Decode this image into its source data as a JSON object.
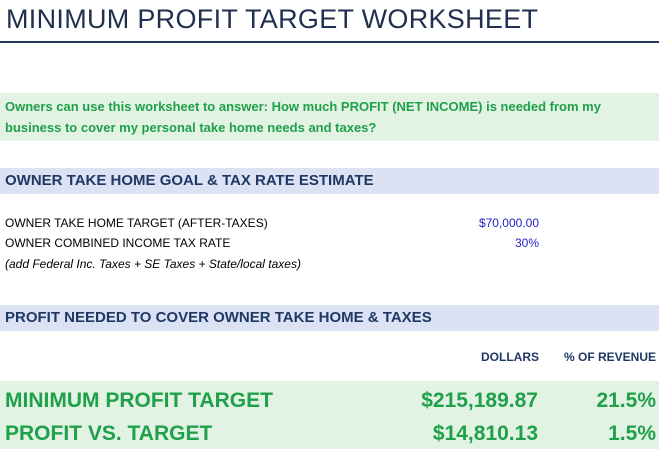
{
  "title": "MINIMUM PROFIT TARGET WORKSHEET",
  "intro": "Owners can use this worksheet to answer: How much PROFIT (NET INCOME) is needed from my business to cover my personal take home needs and taxes?",
  "section1": {
    "title": "OWNER TAKE HOME GOAL & TAX RATE ESTIMATE",
    "rows": [
      {
        "label": "OWNER TAKE HOME TARGET (AFTER-TAXES)",
        "value": "$70,000.00"
      },
      {
        "label": "OWNER COMBINED INCOME TAX RATE",
        "value": "30%"
      }
    ],
    "note": "(add Federal Inc. Taxes + SE Taxes + State/local taxes)"
  },
  "section2": {
    "title": "PROFIT NEEDED TO COVER OWNER TAKE HOME & TAXES",
    "headers": {
      "dollars": "DOLLARS",
      "percent": "% OF REVENUE"
    },
    "rows": [
      {
        "label": "MINIMUM PROFIT TARGET",
        "dollars": "$215,189.87",
        "percent": "21.5%"
      },
      {
        "label": "PROFIT VS. TARGET",
        "dollars": "$14,810.13",
        "percent": "1.5%"
      }
    ]
  },
  "colors": {
    "title": "#1f2f4f",
    "accent_green": "#1fa04a",
    "green_fill": "#e3f3e3",
    "section_fill": "#dbe2f4",
    "section_text": "#1f3864",
    "input_blue": "#1f1fc8"
  }
}
